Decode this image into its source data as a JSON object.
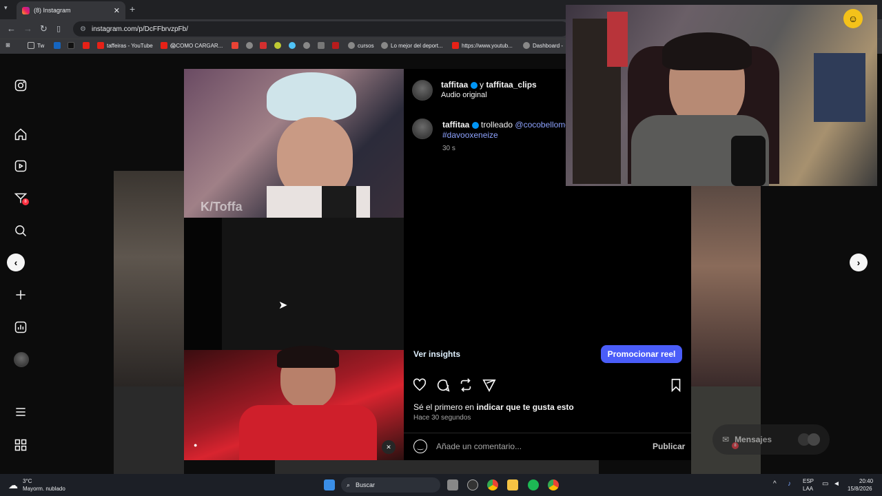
{
  "browser": {
    "tab_title": "(8) Instagram",
    "url": "instagram.com/p/DcFFbrvzpFb/",
    "bookmarks": [
      "Tw",
      "taffeiras - YouTube",
      "😱COMO CARGAR...",
      "cursos",
      "Lo mejor del deport...",
      "https://www.youtub...",
      "Dashboard -"
    ]
  },
  "sidebar": {
    "notification_count": "8"
  },
  "post": {
    "author": "taffitaa",
    "collab": "taffitaa_clips",
    "collab_joiner": "y",
    "audio": "Audio original",
    "caption_text": "trolleado",
    "caption_mention": "@cocobellomo",
    "caption_hashtag": "#davooxeneize",
    "caption_time": "30 s",
    "watermark": "K/Toffa",
    "insights_label": "Ver insights",
    "promote_label": "Promocionar reel",
    "likes_prefix": "Sé el primero en",
    "likes_link": "indicar que te gusta esto",
    "time_ago": "Hace 30 segundos",
    "comment_placeholder": "Añade un comentario...",
    "publish_label": "Publicar"
  },
  "messages": {
    "label": "Mensajes",
    "badge": "8"
  },
  "taskbar": {
    "weather_temp": "3°C",
    "weather_desc": "Mayorm. nublado",
    "search_label": "Buscar",
    "lang_top": "ESP",
    "lang_bottom": "LAA",
    "time": "20:40",
    "date": "15/8/2026"
  },
  "colors": {
    "accent": "#4a5df9",
    "verified": "#0095f6",
    "badge": "#ff3040"
  }
}
